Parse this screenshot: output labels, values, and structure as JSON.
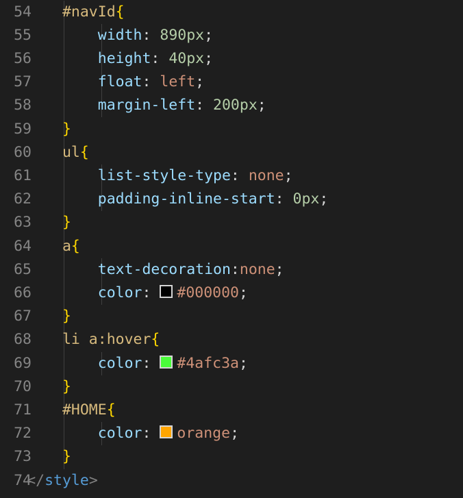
{
  "editor": {
    "colors": {
      "background": "#1e1e1e",
      "line_number": "#858585",
      "selector": "#d7ba7d",
      "brace": "#ffd700",
      "property": "#9cdcfe",
      "number": "#b5cea8",
      "value": "#ce9178",
      "punctuation": "#d4d4d4",
      "tag": "#569cd6"
    },
    "lines": [
      {
        "num": "54",
        "code": "    #navId{"
      },
      {
        "num": "55",
        "code": "        width: 890px;"
      },
      {
        "num": "56",
        "code": "        height: 40px;"
      },
      {
        "num": "57",
        "code": "        float: left;"
      },
      {
        "num": "58",
        "code": "        margin-left: 200px;"
      },
      {
        "num": "59",
        "code": "    }"
      },
      {
        "num": "60",
        "code": "    ul{"
      },
      {
        "num": "61",
        "code": "        list-style-type: none;"
      },
      {
        "num": "62",
        "code": "        padding-inline-start: 0px;"
      },
      {
        "num": "63",
        "code": "    }"
      },
      {
        "num": "64",
        "code": "    a{"
      },
      {
        "num": "65",
        "code": "        text-decoration:none;"
      },
      {
        "num": "66",
        "code": "        color: #000000;",
        "swatch": "#000000"
      },
      {
        "num": "67",
        "code": "    }"
      },
      {
        "num": "68",
        "code": "    li a:hover{"
      },
      {
        "num": "69",
        "code": "        color: #4afc3a;",
        "swatch": "#4afc3a"
      },
      {
        "num": "70",
        "code": "    }"
      },
      {
        "num": "71",
        "code": "    #HOME{"
      },
      {
        "num": "72",
        "code": "        color: orange;",
        "swatch": "orange"
      },
      {
        "num": "73",
        "code": "    }"
      },
      {
        "num": "74",
        "code": "</style>"
      }
    ]
  }
}
